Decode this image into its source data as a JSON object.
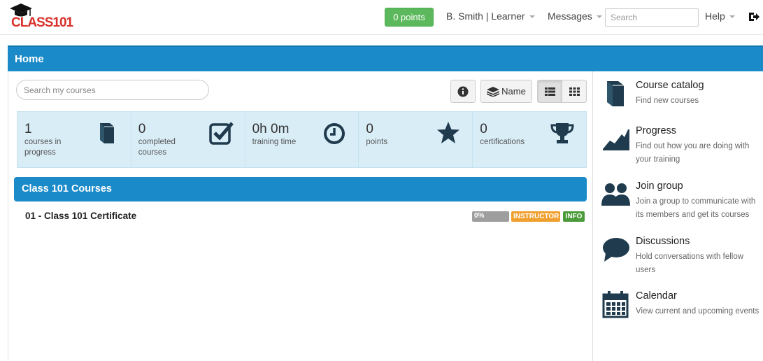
{
  "app": {
    "logo_text": "CLASS101"
  },
  "topnav": {
    "points_label": "0 points",
    "user_label": "B. Smith | Learner",
    "messages_label": "Messages",
    "search_placeholder": "Search",
    "help_label": "Help",
    "logout_icon": "logout-icon"
  },
  "home": {
    "title": "Home"
  },
  "toolbar": {
    "course_search_placeholder": "Search my courses",
    "sort_label": "Name",
    "icons": [
      "info-icon",
      "layers-icon",
      "list-view-icon",
      "grid-view-icon"
    ]
  },
  "stats": [
    {
      "value": "1",
      "label": "courses in progress",
      "icon": "book-icon"
    },
    {
      "value": "0",
      "label": "completed courses",
      "icon": "checkbox-icon"
    },
    {
      "value": "0h 0m",
      "label": "training time",
      "icon": "clock-icon"
    },
    {
      "value": "0",
      "label": "points",
      "icon": "star-icon"
    },
    {
      "value": "0",
      "label": "certifications",
      "icon": "trophy-icon"
    }
  ],
  "courses": {
    "title": "Class 101 Courses",
    "items": [
      {
        "name": "01 - Class 101 Certificate",
        "progress_label": "0%",
        "progress": 0,
        "badges": [
          "INSTRUCTOR",
          "INFO"
        ]
      }
    ]
  },
  "side_links": [
    {
      "title": "Course catalog",
      "description": "Find new courses",
      "icon": "book-icon"
    },
    {
      "title": "Progress",
      "description": "Find out how you are doing with your training",
      "icon": "chart-icon"
    },
    {
      "title": "Join group",
      "description": "Join a group to communicate with its members and get its courses",
      "icon": "users-icon"
    },
    {
      "title": "Discussions",
      "description": "Hold conversations with fellow users",
      "icon": "speech-bubble-icon"
    },
    {
      "title": "Calendar",
      "description": "View current and upcoming events",
      "icon": "calendar-icon"
    }
  ],
  "colors": {
    "primary": "#1a8ac8",
    "success": "#5cb85c",
    "stats_bg": "#d9edf7",
    "instructor_badge": "#f0a030",
    "info_badge": "#4b9b3b",
    "logo_red": "#d9312b",
    "icon_dark": "#1f3b4d"
  }
}
